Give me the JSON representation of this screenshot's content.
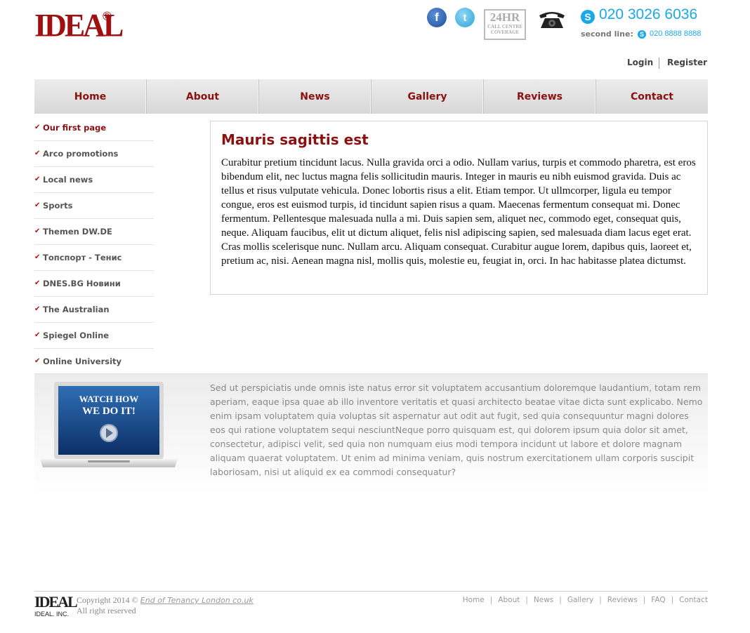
{
  "brand": {
    "logo_text": "IDEAL",
    "reg": "®",
    "footer_logo": "IDEAL",
    "footer_inc": "IDEAL. INC."
  },
  "header": {
    "badge_24": "24HR",
    "badge_sub": "CALL CENTRE COVERAGE",
    "phone_main": "020 3026 6036",
    "second_line_label": "second line:",
    "phone_second": "020 8888 8888",
    "login": "Login",
    "register": "Register"
  },
  "nav": {
    "items": [
      "Home",
      "About",
      "News",
      "Gallery",
      "Reviews",
      "Contact"
    ]
  },
  "sidebar": {
    "items": [
      "Our first page",
      "Arco promotions",
      "Local news",
      "Sports",
      "Themen DW.DE",
      "Топспорт - Тенис",
      "DNES.BG Новини",
      "The Australian",
      "Spiegel Online",
      "Online University"
    ]
  },
  "main": {
    "title": "Mauris sagittis est",
    "body": "Curabitur pretium tincidunt lacus. Nulla gravida orci a odio. Nullam varius, turpis et commodo pharetra, est eros bibendum elit, nec luctus magna felis sollicitudin mauris. Integer in mauris eu nibh euismod gravida. Duis ac tellus et risus vulputate vehicula. Donec lobortis risus a elit. Etiam tempor. Ut ullmcorper, ligula eu tempor congue, eros est euismod turpis, id tincidunt sapien risus a quam. Maecenas fermentum consequat mi. Donec fermentum. Pellentesque malesuada nulla a mi. Duis sapien sem, aliquet nec, commodo eget, consequat quis, neque. Aliquam faucibus, elit ut dictum aliquet, felis nisl adipiscing sapien, sed malesuada diam lacus eget erat. Cras mollis scelerisque nunc. Nullam arcu. Aliquam consequat. Curabitur augue lorem, dapibus quis, laoreet et, pretium ac, nisi. Aenean magna nisl, mollis quis, molestie eu, feugiat in, orci. In hac habitasse platea dictumst."
  },
  "promo": {
    "video_line1": "WATCH HOW",
    "video_line2": "WE DO IT!",
    "text": "Sed ut perspiciatis unde omnis iste natus error sit voluptatem accusantium doloremque laudantium, totam rem aperiam, eaque ipsa quae ab illo inventore veritatis et quasi architecto beatae vitae dicta sunt explicabo. Nemo enim ipsam voluptatem quia voluptas sit aspernatur aut odit aut fugit, sed quia consequuntur magni dolores eos qui ratione voluptatem sequi nesciuntNeque porro quisquam est, qui dolorem ipsum quia dolor sit amet, consectetur, adipisci velit, sed quia non numquam eius modi tempora incidunt ut labore et dolore magnam aliquam quaerat voluptatem. Ut enim ad minima veniam, quis nostrum exercitationem ullam corporis suscipit laboriosam, nisi ut aliquid ex ea commodi consequatur?"
  },
  "footer": {
    "copyright_prefix": "Copyright 2014 ©",
    "copyright_link": "End of Tenancy London co.uk",
    "rights": "All right reserved",
    "nav": [
      "Home",
      "About",
      "News",
      "Gallery",
      "Reviews",
      "FAQ",
      "Contact"
    ]
  },
  "colors": {
    "brand_red": "#8b1010",
    "skype_blue": "#1aa9e8"
  },
  "icons": [
    "facebook-icon",
    "twitter-icon",
    "telephone-icon",
    "skype-icon",
    "check-icon",
    "play-icon"
  ]
}
